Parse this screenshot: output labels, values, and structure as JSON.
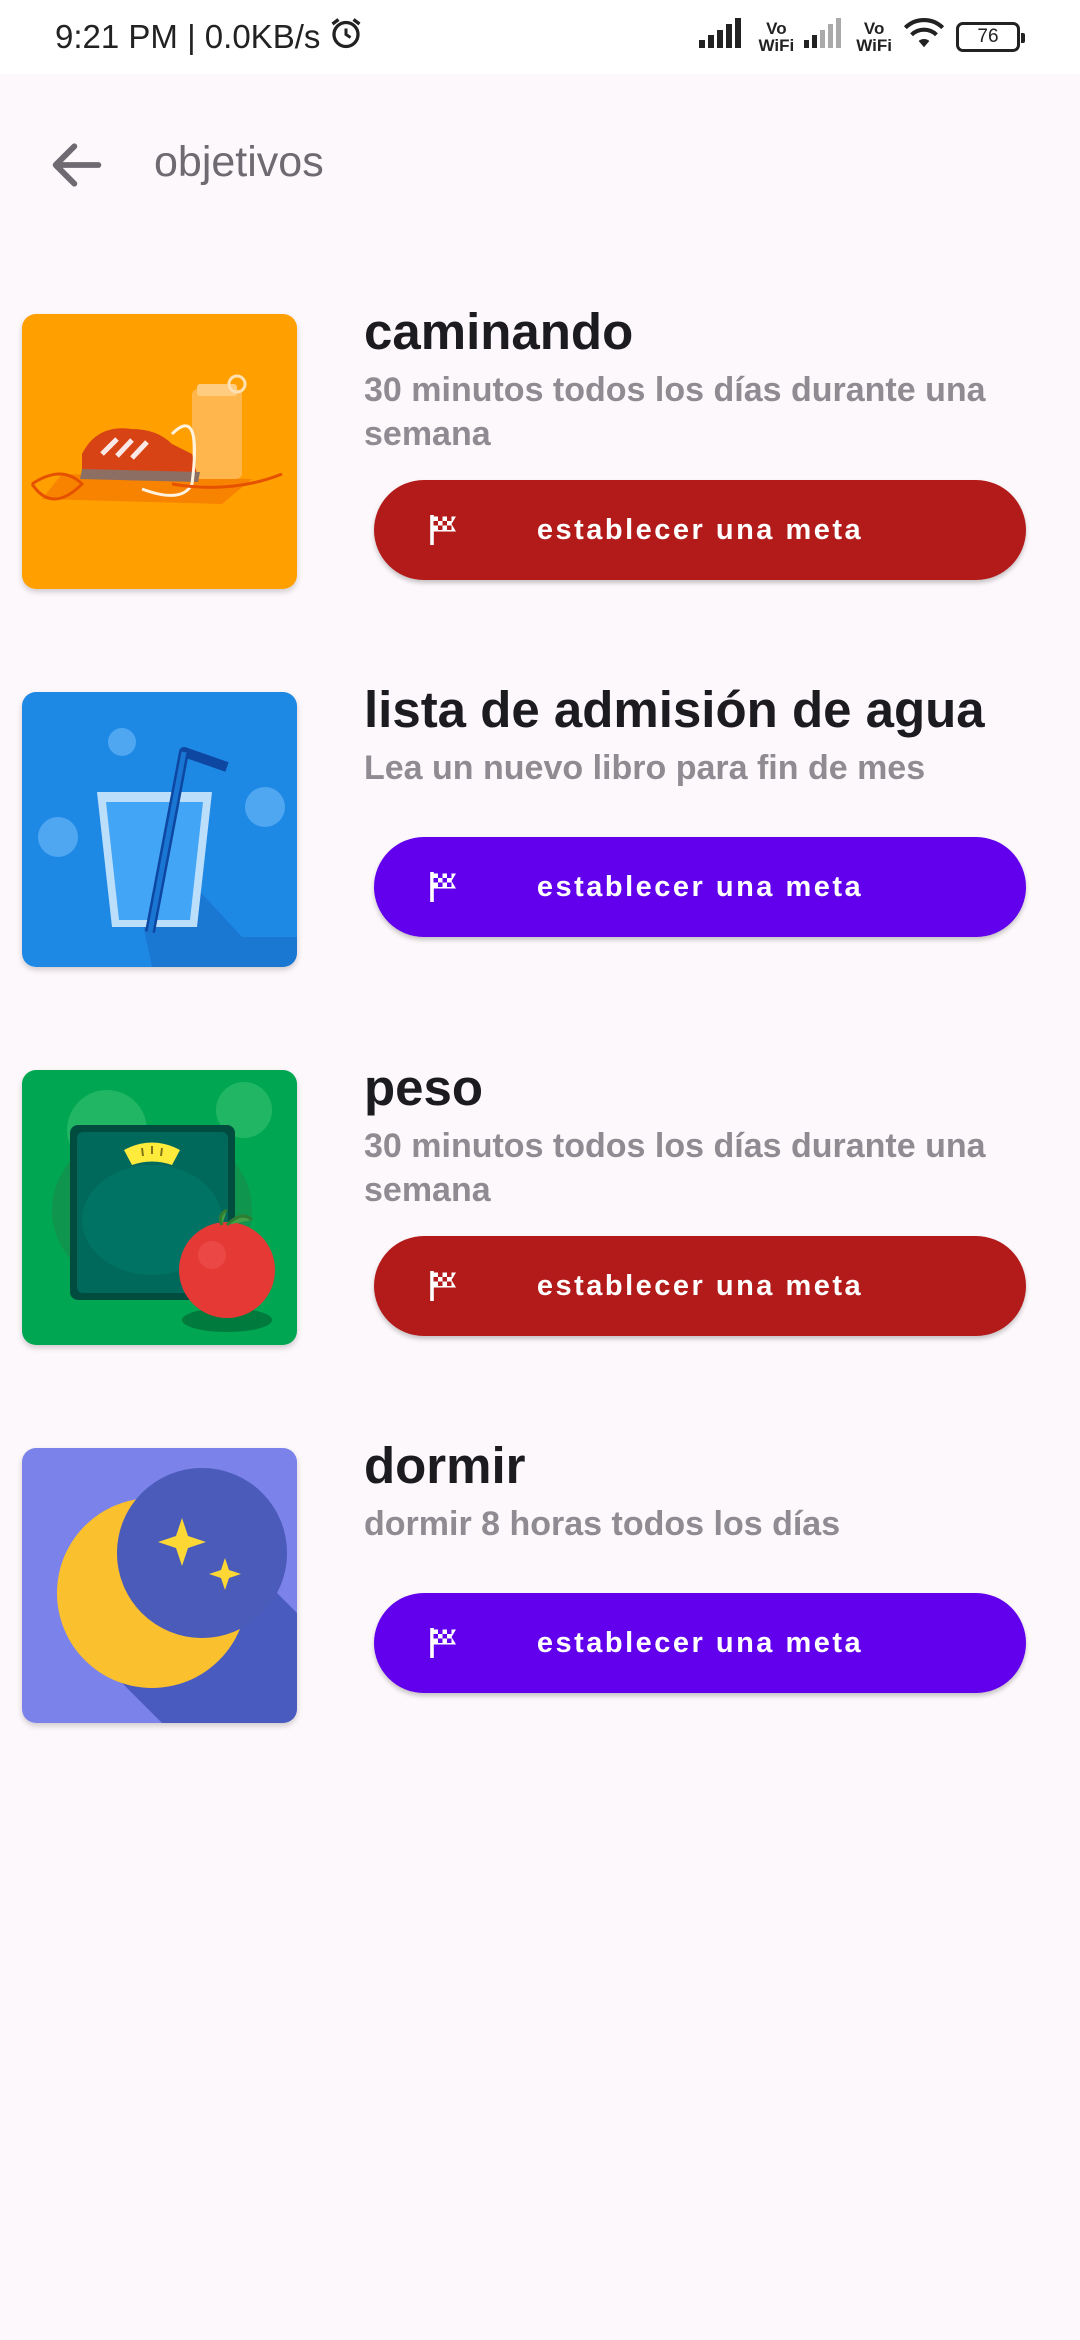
{
  "status_bar": {
    "time_net": "9:21 PM | 0.0KB/s",
    "vowifi_top": "Vo",
    "vowifi_bottom": "WiFi",
    "battery": "76"
  },
  "header": {
    "title": "objetivos"
  },
  "goals": [
    {
      "title": "caminando",
      "description": "30 minutos todos los días durante una semana",
      "button_label": "establecer una meta",
      "button_color": "#b31b1b"
    },
    {
      "title": "lista de admisión de agua",
      "description": "Lea un nuevo libro para fin de mes",
      "button_label": "establecer una meta",
      "button_color": "#6200ee"
    },
    {
      "title": "peso",
      "description": "30 minutos todos los días durante una semana",
      "button_label": "establecer una meta",
      "button_color": "#b31b1b"
    },
    {
      "title": "dormir",
      "description": "dormir 8 horas todos los días",
      "button_label": "establecer una meta",
      "button_color": "#6200ee"
    }
  ],
  "icons": {
    "back": "arrow-left-icon",
    "alarm": "alarm-clock-icon",
    "signal": "cell-signal-icon",
    "wifi": "wifi-icon",
    "flag": "checkered-flag-icon"
  }
}
